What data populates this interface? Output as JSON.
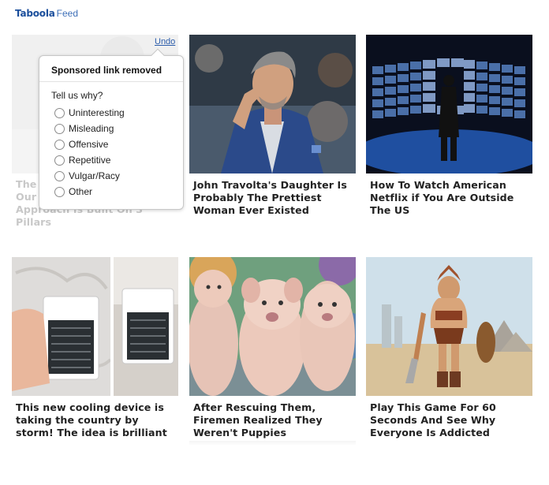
{
  "brand": {
    "logo": "Taboola",
    "feed": "Feed"
  },
  "removed_card": {
    "title": "The Our Approach Is Built On 3 Pillars",
    "title_visible_line1": "The",
    "title_visible_line2": "Our",
    "title_visible_line3": "Approach Is Built On 3 Pillars",
    "undo_label": "Undo"
  },
  "feedback_popup": {
    "header": "Sponsored link removed",
    "prompt": "Tell us why?",
    "reasons": [
      "Uninteresting",
      "Misleading",
      "Offensive",
      "Repetitive",
      "Vulgar/Racy",
      "Other"
    ]
  },
  "cards": [
    {
      "title": "John Travolta's Daughter Is Probably The Prettiest Woman Ever Existed"
    },
    {
      "title": "How To Watch American Netflix if You Are Outside The US"
    },
    {
      "title": "This new cooling device is taking the country by storm! The idea is brilliant"
    },
    {
      "title": "After Rescuing Them, Firemen Realized They Weren't Puppies"
    },
    {
      "title": "Play This Game For 60 Seconds And See Why Everyone Is Addicted"
    }
  ],
  "colors": {
    "brand_blue": "#1b4f9c",
    "link_blue": "#2b5cab",
    "title_text": "#222222",
    "faded_text": "#c8c8c8"
  }
}
